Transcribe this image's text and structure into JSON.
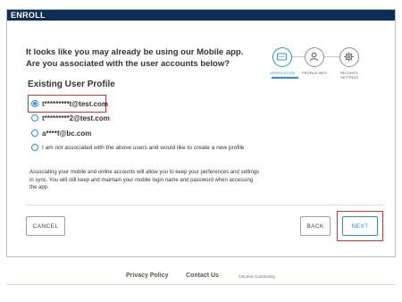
{
  "window": {
    "title": "ENROLL"
  },
  "prompt": {
    "line1": "It looks like you may already be using our Mobile app.",
    "line2": "Are you associated with the user accounts below?"
  },
  "section_title": "Existing User Profile",
  "stepper": {
    "steps": [
      {
        "label": "VERIFICATION",
        "icon": "verification-icon",
        "active": true
      },
      {
        "label": "PROFILE INFO",
        "icon": "person-icon",
        "active": false
      },
      {
        "label": "SECURITY SETTINGS",
        "icon": "gear-icon",
        "active": false
      }
    ]
  },
  "options": [
    {
      "label": "t*********t@test.com",
      "checked": true
    },
    {
      "label": "t*********2@test.com",
      "checked": false
    },
    {
      "label": "a****f@bc.com",
      "checked": false
    },
    {
      "label": "I am not associated with the above users and would like to create a new profile",
      "checked": false
    }
  ],
  "info_text": "Associating your mobile and online accounts will allow you to keep your perferences and settings in sync. You will still keep and maintain your mobile login name and password when accessing the app.",
  "buttons": {
    "cancel": "CANCEL",
    "back": "BACK",
    "next": "NEXT"
  },
  "footer": {
    "privacy": "Privacy Policy",
    "contact": "Contact Us",
    "copyright": "©Scenic Community"
  },
  "colors": {
    "header": "#0c2f57",
    "accent": "#2a8fd6",
    "highlight": "#dd3333"
  }
}
